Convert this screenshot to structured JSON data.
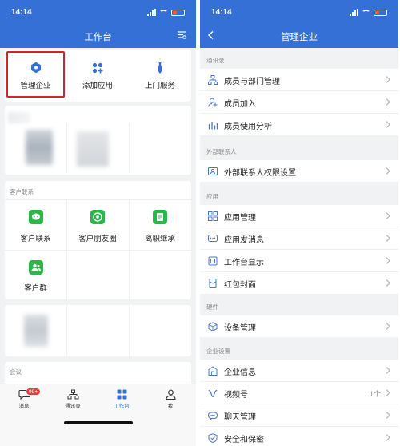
{
  "status": {
    "time": "14:14"
  },
  "left": {
    "title": "工作台",
    "quick_tools": [
      {
        "label": "管理企业",
        "icon": "hexagon-admin-icon"
      },
      {
        "label": "添加应用",
        "icon": "add-apps-icon"
      },
      {
        "label": "上门服务",
        "icon": "tie-service-icon"
      }
    ],
    "section_customer": "客户联系",
    "customer_apps": [
      {
        "label": "客户联系",
        "icon": "chat-bubble-icon"
      },
      {
        "label": "客户朋友圈",
        "icon": "moments-icon"
      },
      {
        "label": "离职继承",
        "icon": "document-icon"
      },
      {
        "label": "客户群",
        "icon": "group-icon"
      }
    ],
    "section_meeting": "会议",
    "tabs": [
      {
        "label": "消息",
        "icon": "message-icon",
        "badge": "99+"
      },
      {
        "label": "通讯录",
        "icon": "contacts-icon"
      },
      {
        "label": "工作台",
        "icon": "workbench-icon",
        "active": true
      },
      {
        "label": "我",
        "icon": "profile-icon"
      }
    ],
    "accent": "#3470d5"
  },
  "right": {
    "title": "管理企业",
    "sections": [
      {
        "label": "通讯录",
        "rows": [
          {
            "label": "成员与部门管理",
            "icon": "org-tree-icon"
          },
          {
            "label": "成员加入",
            "icon": "add-member-icon"
          },
          {
            "label": "成员使用分析",
            "icon": "bar-chart-icon"
          }
        ]
      },
      {
        "label": "外部联系人",
        "rows": [
          {
            "label": "外部联系人权限设置",
            "icon": "contact-card-icon"
          }
        ]
      },
      {
        "label": "应用",
        "rows": [
          {
            "label": "应用管理",
            "icon": "app-grid-icon"
          },
          {
            "label": "应用发消息",
            "icon": "message-box-icon"
          },
          {
            "label": "工作台显示",
            "icon": "display-icon"
          },
          {
            "label": "红包封面",
            "icon": "red-packet-icon"
          }
        ]
      },
      {
        "label": "硬件",
        "rows": [
          {
            "label": "设备管理",
            "icon": "device-box-icon"
          }
        ]
      },
      {
        "label": "企业设置",
        "rows": [
          {
            "label": "企业信息",
            "icon": "building-icon"
          },
          {
            "label": "视频号",
            "icon": "channels-icon",
            "value": "1个"
          },
          {
            "label": "聊天管理",
            "icon": "chat-manage-icon"
          },
          {
            "label": "安全和保密",
            "icon": "shield-icon"
          }
        ]
      }
    ]
  }
}
